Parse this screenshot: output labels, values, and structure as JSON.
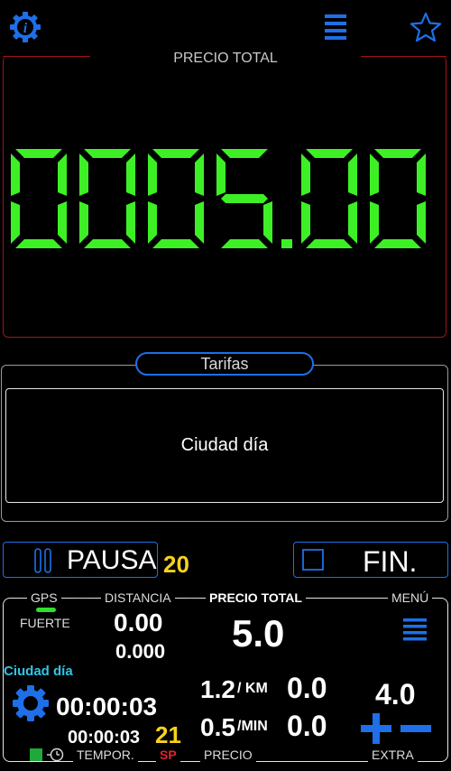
{
  "top_bar": {
    "info_icon": "info-gear-icon",
    "menu_icon": "hamburger-icon",
    "favorite_icon": "star-icon"
  },
  "price": {
    "title": "PRECIO TOTAL",
    "display": "0005.00",
    "color": "#3df025"
  },
  "tarifas": {
    "title": "Tarifas",
    "selected": "Ciudad día"
  },
  "controls": {
    "pause_label": "PAUSA",
    "pause_count": "20",
    "fin_label": "FIN."
  },
  "bottom": {
    "gps_label": "GPS",
    "gps_strength": "FUERTE",
    "distance_label": "DISTANCIA",
    "distance_value": "0.00",
    "distance_sub": "0.000",
    "total_label": "PRECIO TOTAL",
    "total_value": "5.0",
    "menu_label": "MENÚ",
    "tariff_name": "Ciudad día",
    "timer_main": "00:00:03",
    "timer_sub": "00:00:03",
    "timer_count": "21",
    "rate_km": "1.2",
    "rate_km_unit": "/ KM",
    "rate_km_total": "0.0",
    "rate_min": "0.5",
    "rate_min_unit": "/MIN",
    "rate_min_total": "0.0",
    "extra_value": "4.0",
    "footer_tempor": "TEMPOR.",
    "footer_sp": "SP",
    "footer_precio": "PRECIO",
    "footer_extra": "EXTRA"
  }
}
